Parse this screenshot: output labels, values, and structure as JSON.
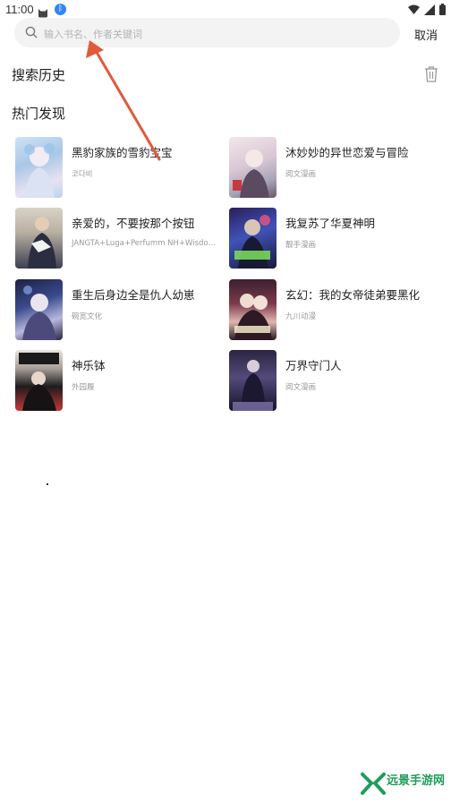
{
  "status_bar": {
    "time": "11:00"
  },
  "search": {
    "placeholder": "输入书名、作者关键词",
    "cancel_label": "取消"
  },
  "history": {
    "title": "搜索历史"
  },
  "discover": {
    "title": "热门发现",
    "books": [
      {
        "title": "黑豹家族的雪豹宝宝",
        "author": "코다비"
      },
      {
        "title": "沐妙妙的异世恋爱与冒险",
        "author": "阅文漫画"
      },
      {
        "title": "亲爱的，不要按那个按钮",
        "author": "JANGTA+Luga+Perfumm NH+Wisdomhou..."
      },
      {
        "title": "我复苏了华夏神明",
        "author": "靓手漫画"
      },
      {
        "title": "重生后身边全是仇人幼崽",
        "author": "碗宽文化"
      },
      {
        "title": "玄幻：我的女帝徒弟要黑化",
        "author": "九川动漫"
      },
      {
        "title": "神乐钵",
        "author": "外园履"
      },
      {
        "title": "万界守门人",
        "author": "阅文漫画"
      }
    ]
  },
  "watermark": {
    "text": "远景手游网"
  }
}
